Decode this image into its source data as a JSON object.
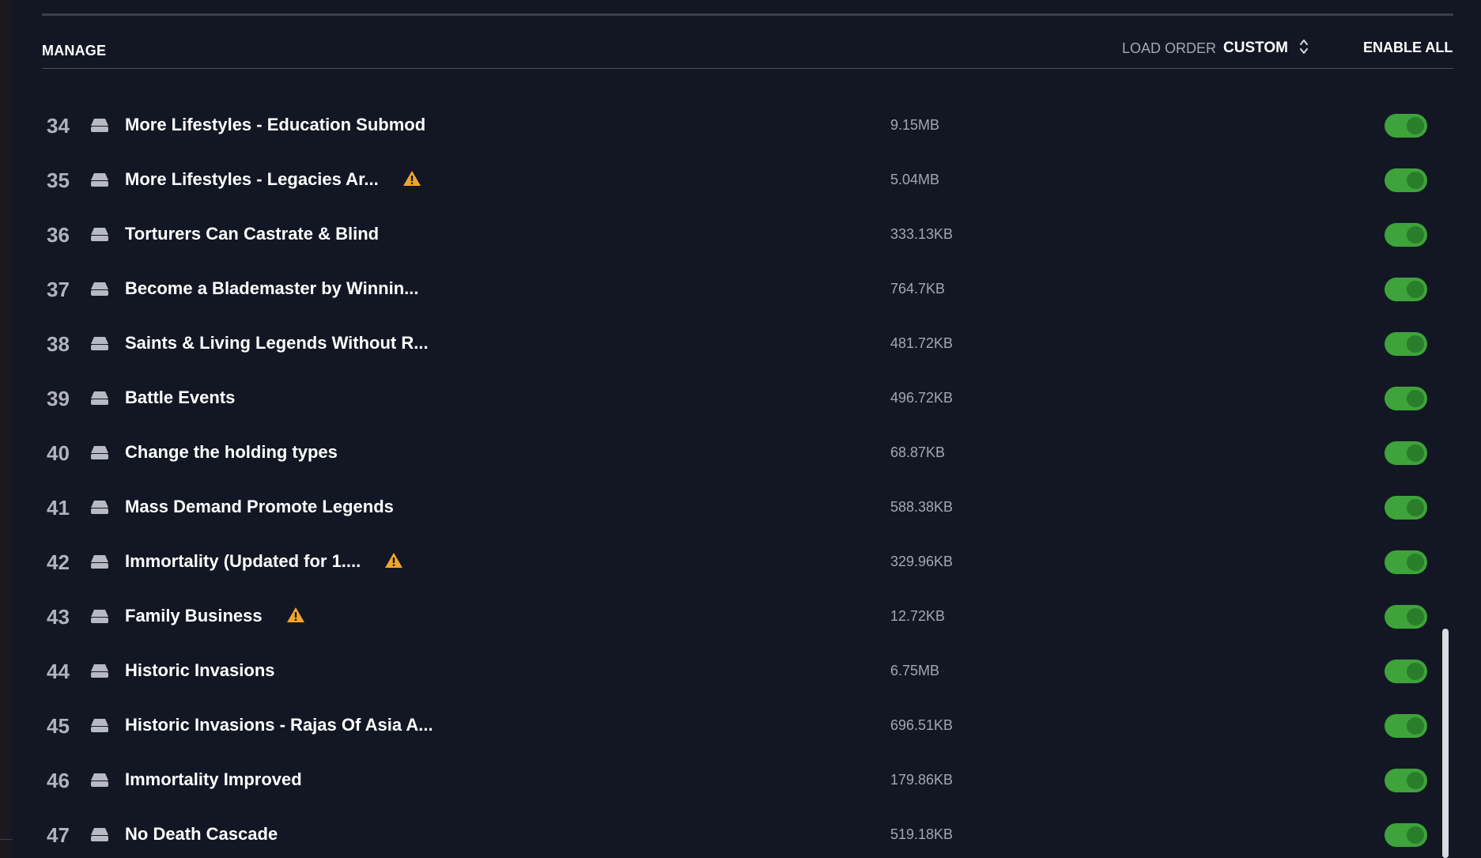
{
  "header": {
    "manage_label": "MANAGE",
    "load_order_label": "LOAD ORDER",
    "load_order_value": "CUSTOM",
    "enable_all_label": "ENABLE ALL"
  },
  "colors": {
    "background": "#131724",
    "toggle_on": "#3ea33a",
    "warning": "#f0a52a"
  },
  "mods": [
    {
      "index": "34",
      "name": "More Lifestyles - Education Submod",
      "size": "9.15MB",
      "warning": false,
      "enabled": true
    },
    {
      "index": "35",
      "name": "More Lifestyles - Legacies Ar...",
      "size": "5.04MB",
      "warning": true,
      "enabled": true
    },
    {
      "index": "36",
      "name": "Torturers Can Castrate & Blind",
      "size": "333.13KB",
      "warning": false,
      "enabled": true
    },
    {
      "index": "37",
      "name": "Become a Blademaster by Winnin...",
      "size": "764.7KB",
      "warning": false,
      "enabled": true
    },
    {
      "index": "38",
      "name": "Saints & Living Legends Without R...",
      "size": "481.72KB",
      "warning": false,
      "enabled": true
    },
    {
      "index": "39",
      "name": "Battle Events",
      "size": "496.72KB",
      "warning": false,
      "enabled": true
    },
    {
      "index": "40",
      "name": "Change the holding types",
      "size": "68.87KB",
      "warning": false,
      "enabled": true
    },
    {
      "index": "41",
      "name": "Mass Demand Promote Legends",
      "size": "588.38KB",
      "warning": false,
      "enabled": true
    },
    {
      "index": "42",
      "name": "Immortality (Updated for 1....",
      "size": "329.96KB",
      "warning": true,
      "enabled": true
    },
    {
      "index": "43",
      "name": "Family Business",
      "size": "12.72KB",
      "warning": true,
      "enabled": true
    },
    {
      "index": "44",
      "name": "Historic Invasions",
      "size": "6.75MB",
      "warning": false,
      "enabled": true
    },
    {
      "index": "45",
      "name": "Historic Invasions - Rajas Of Asia A...",
      "size": "696.51KB",
      "warning": false,
      "enabled": true
    },
    {
      "index": "46",
      "name": "Immortality Improved",
      "size": "179.86KB",
      "warning": false,
      "enabled": true
    },
    {
      "index": "47",
      "name": "No Death Cascade",
      "size": "519.18KB",
      "warning": false,
      "enabled": true
    }
  ]
}
